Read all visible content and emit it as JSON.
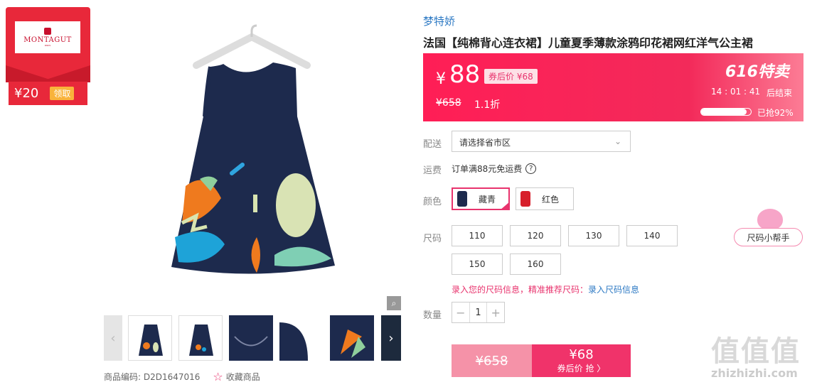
{
  "coupon": {
    "brand": "MONTAGUT",
    "brand_sub": "PARIS",
    "amount": "¥20",
    "claim_label": "领取"
  },
  "gallery": {
    "main_image": "navy-sleeveless-dress",
    "zoom_icon": "magnifier-icon"
  },
  "meta": {
    "sku_label": "商品编码: D2D1647016",
    "favorite_label": "收藏商品"
  },
  "product": {
    "shop": "梦特娇",
    "title": "法国【纯棉背心连衣裙】儿童夏季薄款涂鸦印花裙网红洋气公主裙"
  },
  "price": {
    "currency": "¥",
    "current": "88",
    "after_coupon": "券后价 ¥68",
    "original": "¥658",
    "discount": "1.1折",
    "promo": "616特卖",
    "countdown": "14 : 01 : 41",
    "countdown_suffix": "后结束",
    "sold_percent": 92,
    "sold_label": "已抢92%"
  },
  "shipping": {
    "label": "配送",
    "select_placeholder": "请选择省市区",
    "fee_label": "运费",
    "fee_text": "订单满88元免运费"
  },
  "color": {
    "label": "颜色",
    "options": [
      {
        "label": "藏青",
        "swatch": "#1d2a4d",
        "selected": true
      },
      {
        "label": "红色",
        "swatch": "#d71f2b",
        "selected": false
      }
    ]
  },
  "size": {
    "label": "尺码",
    "options": [
      "110",
      "120",
      "130",
      "140",
      "150",
      "160"
    ],
    "helper_label": "尺码小帮手",
    "note": "录入您的尺码信息，精准推荐尺码：",
    "note_link": "录入尺码信息"
  },
  "quantity": {
    "label": "数量",
    "value": "1"
  },
  "buy": {
    "original": "¥658",
    "price": "¥68",
    "action": "券后价 抢 〉"
  },
  "watermark": {
    "big": "值值值",
    "small": "zhizhizhi.com"
  }
}
